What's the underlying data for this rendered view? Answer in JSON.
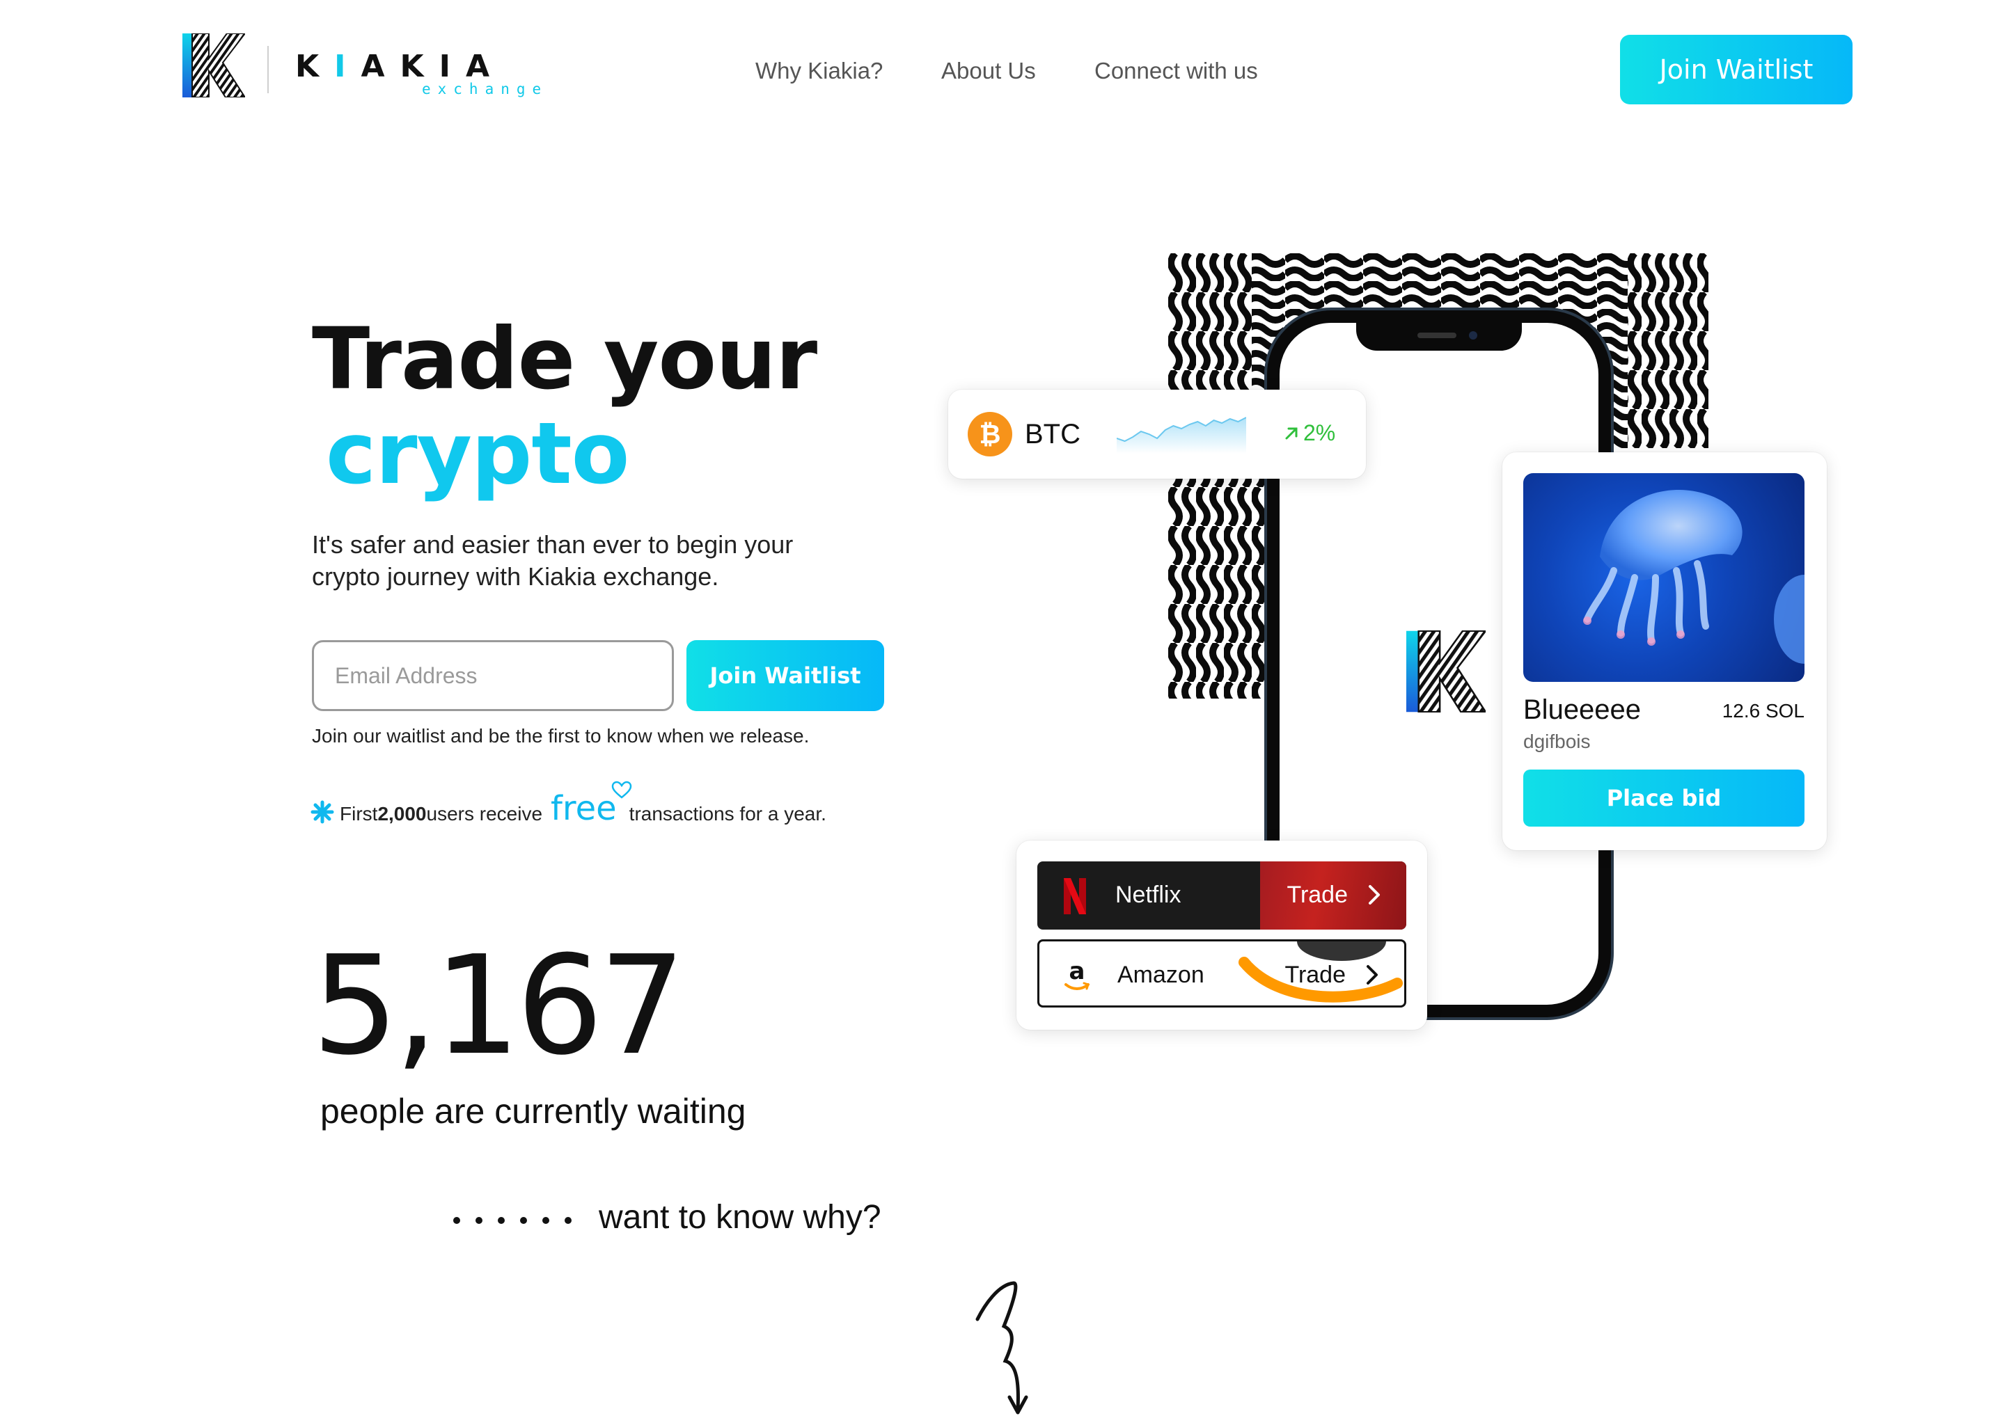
{
  "header": {
    "brand_name": "KIAKIA",
    "brand_sub": "exchange",
    "nav": [
      "Why Kiakia?",
      "About Us",
      "Connect with us"
    ],
    "cta_label": "Join Waitlist"
  },
  "hero": {
    "title_line1": "Trade your",
    "title_line2": "crypto",
    "subtitle": "It's safer and easier than ever to begin your crypto journey with Kiakia exchange.",
    "email_placeholder": "Email Address",
    "join_label": "Join Waitlist",
    "form_note": "Join our waitlist and be the first to know when we release.",
    "promo": {
      "prefix": "First ",
      "count": "2,000",
      "middle": " users receive",
      "highlight": "free",
      "suffix": "transactions for a year."
    },
    "waiting_count": "5,167",
    "waiting_label": "people are currently waiting",
    "why_label": "want to know why?"
  },
  "ticker": {
    "symbol": "BTC",
    "change": "2%",
    "sparkline": [
      40,
      44,
      38,
      30,
      34,
      40,
      28,
      22,
      26,
      20,
      16,
      22,
      14,
      18,
      12,
      16,
      10
    ]
  },
  "nft": {
    "name": "Blueeeee",
    "price": "12.6 SOL",
    "owner": "dgifbois",
    "bid_label": "Place bid"
  },
  "stocks": [
    {
      "name": "Netflix",
      "action": "Trade"
    },
    {
      "name": "Amazon",
      "action": "Trade"
    }
  ],
  "colors": {
    "accent": "#10c8ee",
    "gradient_start": "#11dfe7",
    "gradient_end": "#06b8f8",
    "positive": "#2fbf3b",
    "netflix_red": "#c5221f",
    "amazon_orange": "#ff9900",
    "btc_orange": "#f7931a"
  },
  "icons": {
    "logo": "kiakia-k-logo",
    "star": "sparkle-icon",
    "heart": "heart-icon",
    "btc": "bitcoin-icon",
    "trend": "arrow-up-right-icon",
    "netflix": "netflix-icon",
    "amazon": "amazon-icon",
    "chevron": "chevron-right-icon",
    "arrow": "squiggle-arrow-down-icon"
  }
}
